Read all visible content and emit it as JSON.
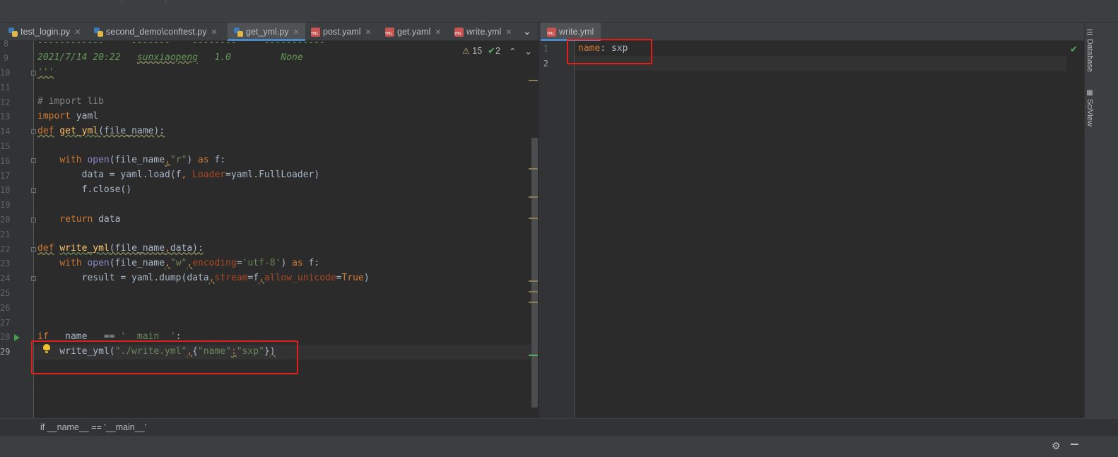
{
  "left_tabs": [
    {
      "label": "test_login.py",
      "type": "py",
      "active": false
    },
    {
      "label": "second_demo\\conftest.py",
      "type": "py",
      "active": false
    },
    {
      "label": "get_yml.py",
      "type": "py",
      "active": true
    },
    {
      "label": "post.yaml",
      "type": "yml",
      "active": false
    },
    {
      "label": "get.yaml",
      "type": "yml",
      "active": false
    },
    {
      "label": "write.yml",
      "type": "yml",
      "active": false
    }
  ],
  "right_tab": {
    "label": "write.yml"
  },
  "inspections": {
    "warnings": "15",
    "weak_warnings": "2"
  },
  "editor": {
    "line_numbers": [
      "8",
      "9",
      "10",
      "11",
      "12",
      "13",
      "14",
      "15",
      "16",
      "17",
      "18",
      "19",
      "20",
      "21",
      "22",
      "23",
      "24",
      "25",
      "26",
      "27",
      "28",
      "29"
    ],
    "partial_line_8": "------------     -------    --------     -----------"
  },
  "yaml_editor": {
    "line_numbers": [
      "1",
      "2"
    ],
    "key": "name",
    "colon": ":",
    "value": "sxp"
  },
  "breadcrumb": "if __name__ == '__main__'",
  "right_sidebar": {
    "database_label": "Database",
    "sciview_label": "SciView"
  },
  "colors": {
    "accent_tab": "#4a88c7",
    "highlight_box": "#e0201c",
    "keyword": "#cc7832",
    "string": "#6a8759"
  }
}
